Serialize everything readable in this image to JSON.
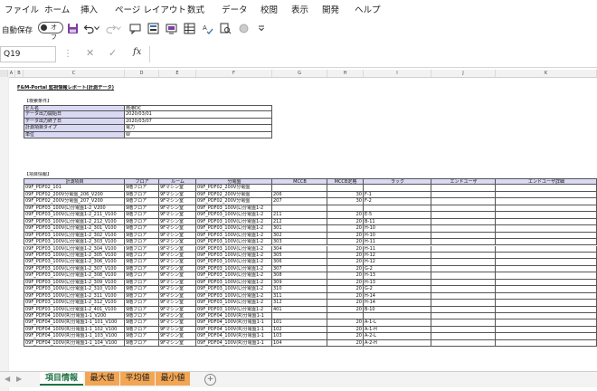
{
  "menu": [
    "ファイル",
    "ホーム",
    "挿入",
    "ページ レイアウト",
    "数式",
    "データ",
    "校閲",
    "表示",
    "開発",
    "ヘルプ"
  ],
  "toolbar": {
    "autosave_label": "自動保存",
    "toggle_state": "オフ"
  },
  "formula_bar": {
    "name_box": "Q19",
    "fx": "fx",
    "value": ""
  },
  "columns": [
    "A",
    "B",
    "C",
    "D",
    "E",
    "F",
    "G",
    "H",
    "I",
    "J",
    "K"
  ],
  "sheet": {
    "title": "F&M-Portal 監視情報レポート(計測データ)",
    "conditions_heading": "【検索条件】",
    "conditions": [
      {
        "label": "ビル名",
        "value": "南港DC"
      },
      {
        "label": "データ出力開始日",
        "value": "2020/03/01"
      },
      {
        "label": "データ出力終了日",
        "value": "2020/03/07"
      },
      {
        "label": "計測項目タイプ",
        "value": "電力"
      },
      {
        "label": "単位",
        "value": "W"
      }
    ],
    "items_heading": "【項目情報】",
    "table_headers": [
      "計測項目",
      "フロア",
      "ルーム",
      "分電盤",
      "MCCB",
      "MCCB定格",
      "ラック",
      "エンドユーザ",
      "エンドユーザ詳細"
    ],
    "rows": [
      [
        "09F_PDF02_101",
        "9階フロア",
        "9Fマシン室",
        "09F_PDF02_200V分電盤",
        "",
        "",
        "",
        "",
        ""
      ],
      [
        "09F_PDF02_200V分電盤_206_V200",
        "9階フロア",
        "9Fマシン室",
        "09F_PDF02_200V分電盤",
        "206",
        "30",
        "F-1",
        "",
        ""
      ],
      [
        "09F_PDF02_200V分電盤_207_V200",
        "9階フロア",
        "9Fマシン室",
        "09F_PDF02_200V分電盤",
        "207",
        "30",
        "F-2",
        "",
        ""
      ],
      [
        "09F_PDF03_100V(L)分電盤1-2_V200",
        "9階フロア",
        "9Fマシン室",
        "09F_PDF03_100V(L)分電盤1-2",
        "",
        "",
        "",
        "",
        ""
      ],
      [
        "09F_PDF03_100V(L)分電盤1-2_211_V100",
        "9階フロア",
        "9Fマシン室",
        "09F_PDF03_100V(L)分電盤1-2",
        "211",
        "20",
        "E-5",
        "",
        ""
      ],
      [
        "09F_PDF03_100V(L)分電盤1-2_212_V100",
        "9階フロア",
        "9Fマシン室",
        "09F_PDF03_100V(L)分電盤1-2",
        "212",
        "20",
        "B-11",
        "",
        ""
      ],
      [
        "09F_PDF03_100V(L)分電盤1-2_301_V100",
        "9階フロア",
        "9Fマシン室",
        "09F_PDF03_100V(L)分電盤1-2",
        "301",
        "20",
        "H-10",
        "",
        ""
      ],
      [
        "09F_PDF03_100V(L)分電盤1-2_302_V100",
        "9階フロア",
        "9Fマシン室",
        "09F_PDF03_100V(L)分電盤1-2",
        "302",
        "20",
        "H-10",
        "",
        ""
      ],
      [
        "09F_PDF03_100V(L)分電盤1-2_303_V100",
        "9階フロア",
        "9Fマシン室",
        "09F_PDF03_100V(L)分電盤1-2",
        "303",
        "20",
        "H-11",
        "",
        ""
      ],
      [
        "09F_PDF03_100V(L)分電盤1-2_304_V100",
        "9階フロア",
        "9Fマシン室",
        "09F_PDF03_100V(L)分電盤1-2",
        "304",
        "20",
        "H-11",
        "",
        ""
      ],
      [
        "09F_PDF03_100V(L)分電盤1-2_305_V100",
        "9階フロア",
        "9Fマシン室",
        "09F_PDF03_100V(L)分電盤1-2",
        "305",
        "20",
        "H-12",
        "",
        ""
      ],
      [
        "09F_PDF03_100V(L)分電盤1-2_306_V100",
        "9階フロア",
        "9Fマシン室",
        "09F_PDF03_100V(L)分電盤1-2",
        "306",
        "20",
        "H-12",
        "",
        ""
      ],
      [
        "09F_PDF03_100V(L)分電盤1-2_307_V100",
        "9階フロア",
        "9Fマシン室",
        "09F_PDF03_100V(L)分電盤1-2",
        "307",
        "20",
        "G-2",
        "",
        ""
      ],
      [
        "09F_PDF03_100V(L)分電盤1-2_308_V100",
        "9階フロア",
        "9Fマシン室",
        "09F_PDF03_100V(L)分電盤1-2",
        "308",
        "20",
        "H-13",
        "",
        ""
      ],
      [
        "09F_PDF03_100V(L)分電盤1-2_309_V100",
        "9階フロア",
        "9Fマシン室",
        "09F_PDF03_100V(L)分電盤1-2",
        "309",
        "20",
        "H-13",
        "",
        ""
      ],
      [
        "09F_PDF03_100V(L)分電盤1-2_310_V100",
        "9階フロア",
        "9Fマシン室",
        "09F_PDF03_100V(L)分電盤1-2",
        "310",
        "20",
        "G-2",
        "",
        ""
      ],
      [
        "09F_PDF03_100V(L)分電盤1-2_311_V100",
        "9階フロア",
        "9Fマシン室",
        "09F_PDF03_100V(L)分電盤1-2",
        "311",
        "20",
        "H-14",
        "",
        ""
      ],
      [
        "09F_PDF03_100V(L)分電盤1-2_312_V100",
        "9階フロア",
        "9Fマシン室",
        "09F_PDF03_100V(L)分電盤1-2",
        "312",
        "20",
        "H-14",
        "",
        ""
      ],
      [
        "09F_PDF03_100V(L)分電盤1-2_401_V100",
        "9階フロア",
        "9Fマシン室",
        "09F_PDF03_100V(L)分電盤1-2",
        "401",
        "20",
        "B-10",
        "",
        ""
      ],
      [
        "09F_PDF04_100V(R)分電盤1-1_V200",
        "9階フロア",
        "9Fマシン室",
        "09F_PDF04_100V(R)分電盤1-1",
        "",
        "",
        "",
        "",
        ""
      ],
      [
        "09F_PDF04_100V(R)分電盤1-1_101_V100",
        "9階フロア",
        "9Fマシン室",
        "09F_PDF04_100V(R)分電盤1-1",
        "101",
        "20",
        "A-1-L",
        "",
        ""
      ],
      [
        "09F_PDF04_100V(R)分電盤1-1_102_V100",
        "9階フロア",
        "9Fマシン室",
        "09F_PDF04_100V(R)分電盤1-1",
        "102",
        "20",
        "A-1-H",
        "",
        ""
      ],
      [
        "09F_PDF04_100V(R)分電盤1-1_103_V100",
        "9階フロア",
        "9Fマシン室",
        "09F_PDF04_100V(R)分電盤1-1",
        "103",
        "20",
        "A-2-L",
        "",
        ""
      ],
      [
        "09F_PDF04_100V(R)分電盤1-1_104_V100",
        "9階フロア",
        "9Fマシン室",
        "09F_PDF04_100V(R)分電盤1-1",
        "104",
        "20",
        "A-2-H",
        "",
        ""
      ]
    ]
  },
  "tabs": [
    {
      "label": "項目情報",
      "style": "active"
    },
    {
      "label": "最大値",
      "style": "orange"
    },
    {
      "label": "平均値",
      "style": "orange"
    },
    {
      "label": "最小値",
      "style": "orange"
    }
  ],
  "add_sheet": "+"
}
